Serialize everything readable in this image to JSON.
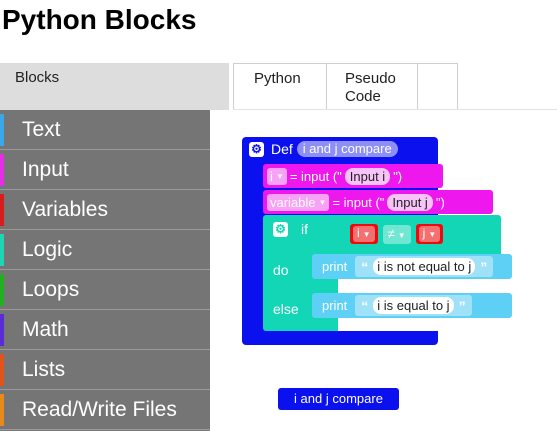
{
  "app": {
    "title": "Python Blocks"
  },
  "tabs": {
    "blocks": "Blocks",
    "python": "Python",
    "pseudo_line1": "Pseudo",
    "pseudo_line2": "Code"
  },
  "toolbox": {
    "categories": [
      {
        "label": "Text",
        "color": "#3aa7e8"
      },
      {
        "label": "Input",
        "color": "#e32ee3"
      },
      {
        "label": "Variables",
        "color": "#d81b1b"
      },
      {
        "label": "Logic",
        "color": "#1fd6b4"
      },
      {
        "label": "Loops",
        "color": "#22b022"
      },
      {
        "label": "Math",
        "color": "#5b2bd9"
      },
      {
        "label": "Lists",
        "color": "#e0541c"
      },
      {
        "label": "Read/Write Files",
        "color": "#e88a1a"
      }
    ]
  },
  "workspace": {
    "def_block": {
      "keyword": "Def",
      "name": "i and j compare"
    },
    "assign_1": {
      "var": "i",
      "equals_input": "= input (\"",
      "prompt": "Input i",
      "close": "\")"
    },
    "assign_2": {
      "var": "variable",
      "equals_input": "= input (\"",
      "prompt": "Input j",
      "close": "\")"
    },
    "if_block": {
      "if_kw": "if",
      "do_kw": "do",
      "else_kw": "else"
    },
    "compare": {
      "left": "i",
      "op": "≠",
      "right": "j"
    },
    "print_1": {
      "keyword": "print",
      "text": "i is not equal to j"
    },
    "print_2": {
      "keyword": "print",
      "text": "i is equal to j"
    },
    "call_block": {
      "label": "i and j compare"
    }
  },
  "colors": {
    "procedure": "#0a10ee",
    "input": "#ee18ee",
    "logic": "#12d6b6",
    "variable": "#ee0a0a",
    "print": "#5fd0f5"
  }
}
